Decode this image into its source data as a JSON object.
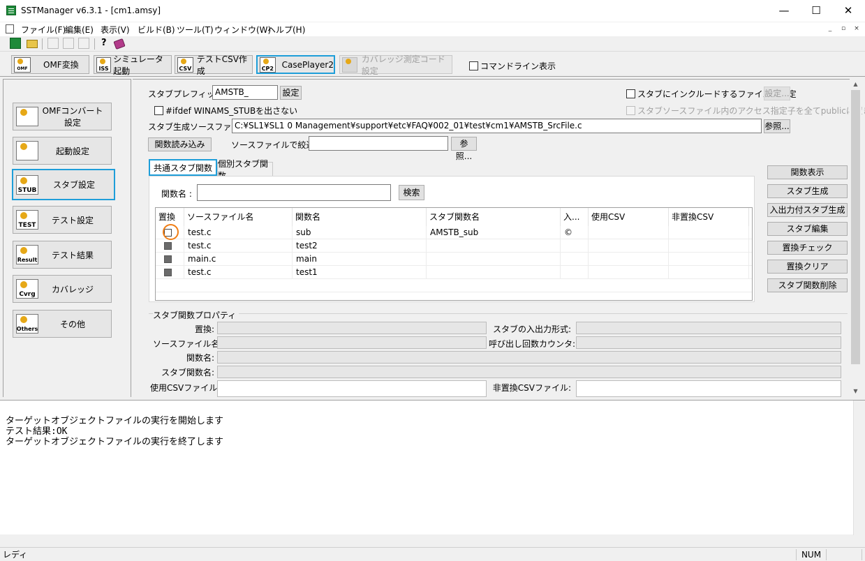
{
  "window": {
    "title": "SSTManager v6.3.1 - [cm1.amsy]",
    "minimize": "—",
    "maximize": "☐",
    "close": "✕"
  },
  "menu": {
    "items": [
      "ファイル(F)",
      "編集(E)",
      "表示(V)",
      "ビルド(B)",
      "ツール(T)",
      "ウィンドウ(W)",
      "ヘルプ(H)"
    ],
    "mdi": [
      "_",
      "▫",
      "×"
    ]
  },
  "toolbar": {
    "icons": [
      "new-icon",
      "open-icon",
      "cut-icon",
      "copy-icon",
      "paste-icon",
      "help-icon",
      "book-icon"
    ],
    "help_glyph": "?",
    "buttons": [
      {
        "label": "OMF変換",
        "icon": "OMF"
      },
      {
        "label": "シミュレータ起動",
        "icon": "ISS"
      },
      {
        "label": "テストCSV作成",
        "icon": "CSV"
      },
      {
        "label": "CasePlayer2",
        "icon": "CP2"
      },
      {
        "label": "カバレッジ測定コード設定",
        "icon": ""
      }
    ],
    "cmdline_label": "コマンドライン表示"
  },
  "nav": [
    {
      "label": "OMFコンバート設定",
      "icon": "OMF"
    },
    {
      "label": "起動設定",
      "icon": ""
    },
    {
      "label": "スタブ設定",
      "icon": "STUB"
    },
    {
      "label": "テスト設定",
      "icon": "TEST"
    },
    {
      "label": "テスト結果",
      "icon": "Result"
    },
    {
      "label": "カバレッジ",
      "icon": "Cvrg"
    },
    {
      "label": "その他",
      "icon": "Others"
    }
  ],
  "stub": {
    "prefix_label": "スタブプレフィックス:",
    "prefix_value": "AMSTB_",
    "prefix_button": "設定",
    "ifdef_label": "#ifdef WINAMS_STUBを出さない",
    "include_label": "スタブにインクルードするファイルを指定",
    "include_button": "設定...",
    "public_label": "スタブソースファイル内のアクセス指定子を全てpublicに置き換える",
    "source_label": "スタブ生成ソースファイル:",
    "source_value": "C:¥SL1¥SL1 0 Management¥support¥etc¥FAQ¥002_01¥test¥cm1¥AMSTB_SrcFile.c",
    "browse_button": "参照...",
    "load_button": "関数読み込み",
    "filter_label": "ソースファイルで絞込み",
    "filter_value": "",
    "filter_browse": "参照..."
  },
  "tabs": [
    "共通スタブ関数",
    "個別スタブ関数"
  ],
  "search": {
    "label": "関数名 :",
    "value": "",
    "button": "検索"
  },
  "table": {
    "columns": [
      "置換",
      "ソースファイル名",
      "関数名",
      "スタブ関数名",
      "入...",
      "使用CSV",
      "非置換CSV"
    ],
    "rows": [
      {
        "checked": false,
        "source": "test.c",
        "func": "sub",
        "stub": "AMSTB_sub",
        "io": "©",
        "csv": "",
        "noncsv": ""
      },
      {
        "checked": true,
        "source": "test.c",
        "func": "test2",
        "stub": "",
        "io": "",
        "csv": "",
        "noncsv": ""
      },
      {
        "checked": true,
        "source": "main.c",
        "func": "main",
        "stub": "",
        "io": "",
        "csv": "",
        "noncsv": ""
      },
      {
        "checked": true,
        "source": "test.c",
        "func": "test1",
        "stub": "",
        "io": "",
        "csv": "",
        "noncsv": ""
      }
    ]
  },
  "side_buttons": [
    "関数表示",
    "スタブ生成",
    "入出力付スタブ生成",
    "スタブ編集",
    "置換チェック",
    "置換クリア",
    "スタブ関数削除"
  ],
  "props": {
    "title": "スタブ関数プロパティ",
    "replace": "置換:",
    "source": "ソースファイル名:",
    "func": "関数名:",
    "stub": "スタブ関数名:",
    "csv": "使用CSVファイル:",
    "io_format": "スタブの入出力形式:",
    "call_counter": "呼び出し回数カウンタ:",
    "noncsv": "非置換CSVファイル:"
  },
  "output": [
    "ターゲットオブジェクトファイルの実行を開始します",
    "テスト結果:OK",
    "ターゲットオブジェクトファイルの実行を終了します"
  ],
  "status": {
    "left": "レディ",
    "num": "NUM"
  },
  "colors": {
    "accent": "#1e9ed9",
    "highlight_ring": "#f07d14"
  }
}
